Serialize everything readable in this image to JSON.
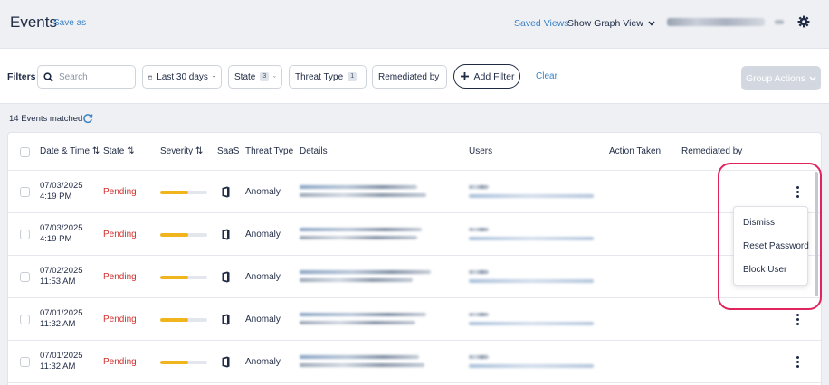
{
  "header": {
    "title": "Events",
    "save_as": "Save as",
    "saved_views": "Saved Views",
    "show_graph_view": "Show Graph View"
  },
  "filters": {
    "label": "Filters",
    "search_placeholder": "Search",
    "date_range": "Last 30 days",
    "state": {
      "label": "State",
      "count": "3"
    },
    "threat_type": {
      "label": "Threat Type",
      "count": "1"
    },
    "remediated_by": "Remediated by",
    "add_filter": "Add Filter",
    "clear": "Clear",
    "group_actions": "Group Actions"
  },
  "summary": {
    "events_matched": "14 Events matched"
  },
  "table": {
    "columns": [
      "Date & Time",
      "State",
      "Severity",
      "SaaS",
      "Threat Type",
      "Details",
      "Users",
      "Action Taken",
      "Remediated by"
    ],
    "rows": [
      {
        "date": "07/03/2025",
        "time": "4:19 PM",
        "state": "Pending",
        "severity": 0.6,
        "threat_type": "Anomaly"
      },
      {
        "date": "07/03/2025",
        "time": "4:19 PM",
        "state": "Pending",
        "severity": 0.6,
        "threat_type": "Anomaly"
      },
      {
        "date": "07/02/2025",
        "time": "11:53 AM",
        "state": "Pending",
        "severity": 0.6,
        "threat_type": "Anomaly"
      },
      {
        "date": "07/01/2025",
        "time": "11:32 AM",
        "state": "Pending",
        "severity": 0.6,
        "threat_type": "Anomaly"
      },
      {
        "date": "07/01/2025",
        "time": "11:32 AM",
        "state": "Pending",
        "severity": 0.6,
        "threat_type": "Anomaly"
      }
    ]
  },
  "row_menu": {
    "items": [
      "Dismiss",
      "Reset Password",
      "Block User"
    ]
  },
  "colors": {
    "pending": "#d0312d",
    "severity": "#f0b51c",
    "link": "#3b82c4",
    "highlight": "#e0245e"
  }
}
